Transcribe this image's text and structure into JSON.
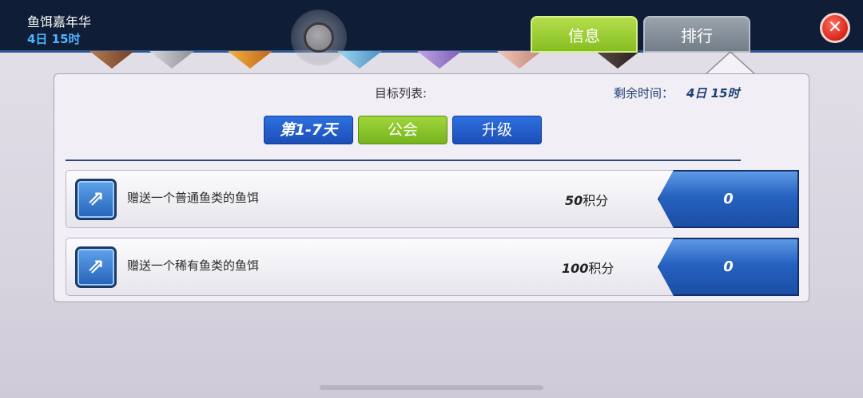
{
  "header": {
    "event_title": "鱼饵嘉年华",
    "event_time": "4日 15时",
    "tabs": [
      {
        "label": "信息",
        "active": true
      },
      {
        "label": "排行",
        "active": false
      }
    ],
    "close_icon": "close-x-icon"
  },
  "panel": {
    "title": "目标列表:",
    "remaining_label": "剩余时间：",
    "remaining_value": "4日 15时",
    "subtabs": [
      {
        "label": "第1-7天"
      },
      {
        "label": "公会"
      },
      {
        "label": "升级"
      }
    ],
    "tasks": [
      {
        "description": "赠送一个普通鱼类的鱼饵",
        "points_value": "50",
        "points_unit": "积分",
        "progress": "0",
        "icon": "share-icon"
      },
      {
        "description": "赠送一个稀有鱼类的鱼饵",
        "points_value": "100",
        "points_unit": "积分",
        "progress": "0",
        "icon": "share-icon"
      }
    ]
  },
  "colors": {
    "header_bg": "#0f1e36",
    "tab_active": "#86be22",
    "tab_inactive": "#727d88",
    "blue_button": "#1c4fb8",
    "green_button": "#77b41e",
    "close_red": "#d8261a"
  }
}
